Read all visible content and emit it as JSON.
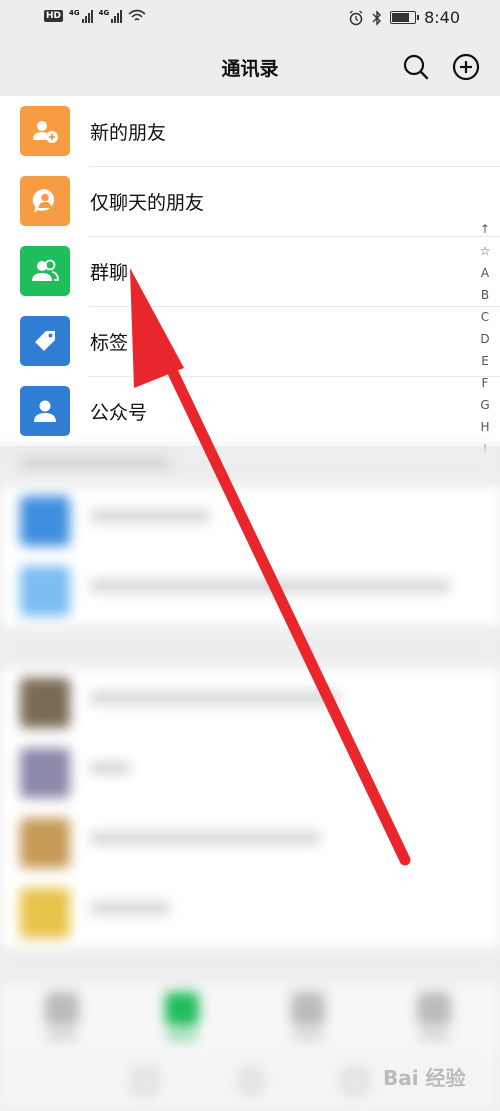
{
  "status_bar": {
    "hd": "HD",
    "net1": "4G",
    "net2": "4G",
    "time": "8:40"
  },
  "header": {
    "title": "通讯录",
    "search_icon": "search-icon",
    "add_icon": "add-circle-icon"
  },
  "functions": [
    {
      "label": "新的朋友",
      "icon": "add-friend-icon",
      "color": "#f79c42"
    },
    {
      "label": "仅聊天的朋友",
      "icon": "chat-only-friend-icon",
      "color": "#f79c42"
    },
    {
      "label": "群聊",
      "icon": "group-chat-icon",
      "color": "#1fbd5b"
    },
    {
      "label": "标签",
      "icon": "tag-icon",
      "color": "#2f7dd4"
    },
    {
      "label": "公众号",
      "icon": "official-account-icon",
      "color": "#2f7dd4"
    }
  ],
  "alpha_index": [
    "↑",
    "☆",
    "A",
    "B",
    "C",
    "D",
    "E",
    "F",
    "G",
    "H",
    "I"
  ],
  "annotation": {
    "arrow_color": "#e8262b"
  },
  "watermark": "Bai 经验"
}
